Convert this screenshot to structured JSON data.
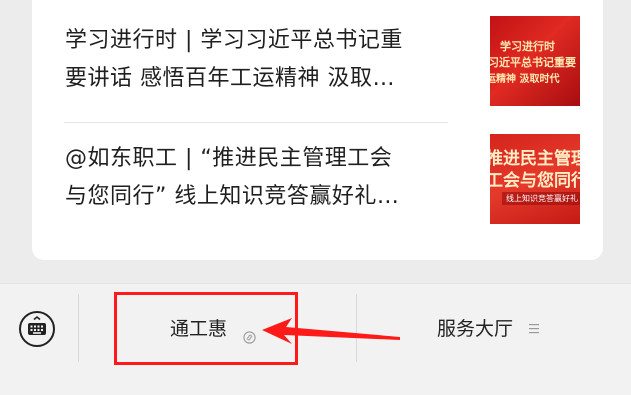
{
  "articles": [
    {
      "title_line1": "学习进行时 | 学习习近平总书记重",
      "title_line2": "要讲话 感悟百年工运精神  汲取…",
      "thumbnail": {
        "line1": "学习进行时",
        "line2": "习近平总书记重要",
        "line3": "运精神  汲取时代"
      }
    },
    {
      "title_line1": "@如东职工 | “推进民主管理工会",
      "title_line2": "与您同行” 线上知识竞答赢好礼…",
      "thumbnail": {
        "line1": "推进民主管理",
        "line2": "工会与您同行",
        "line3": "线上知识竞答赢好礼"
      }
    }
  ],
  "bottom_menu": {
    "keyboard_icon": "keyboard-icon",
    "items": [
      {
        "label": "通工惠",
        "icon": "mini-program-icon"
      },
      {
        "label": "服务大厅",
        "icon": "menu-list-icon"
      }
    ]
  },
  "annotation": {
    "highlight_color": "#ff1a1a"
  }
}
